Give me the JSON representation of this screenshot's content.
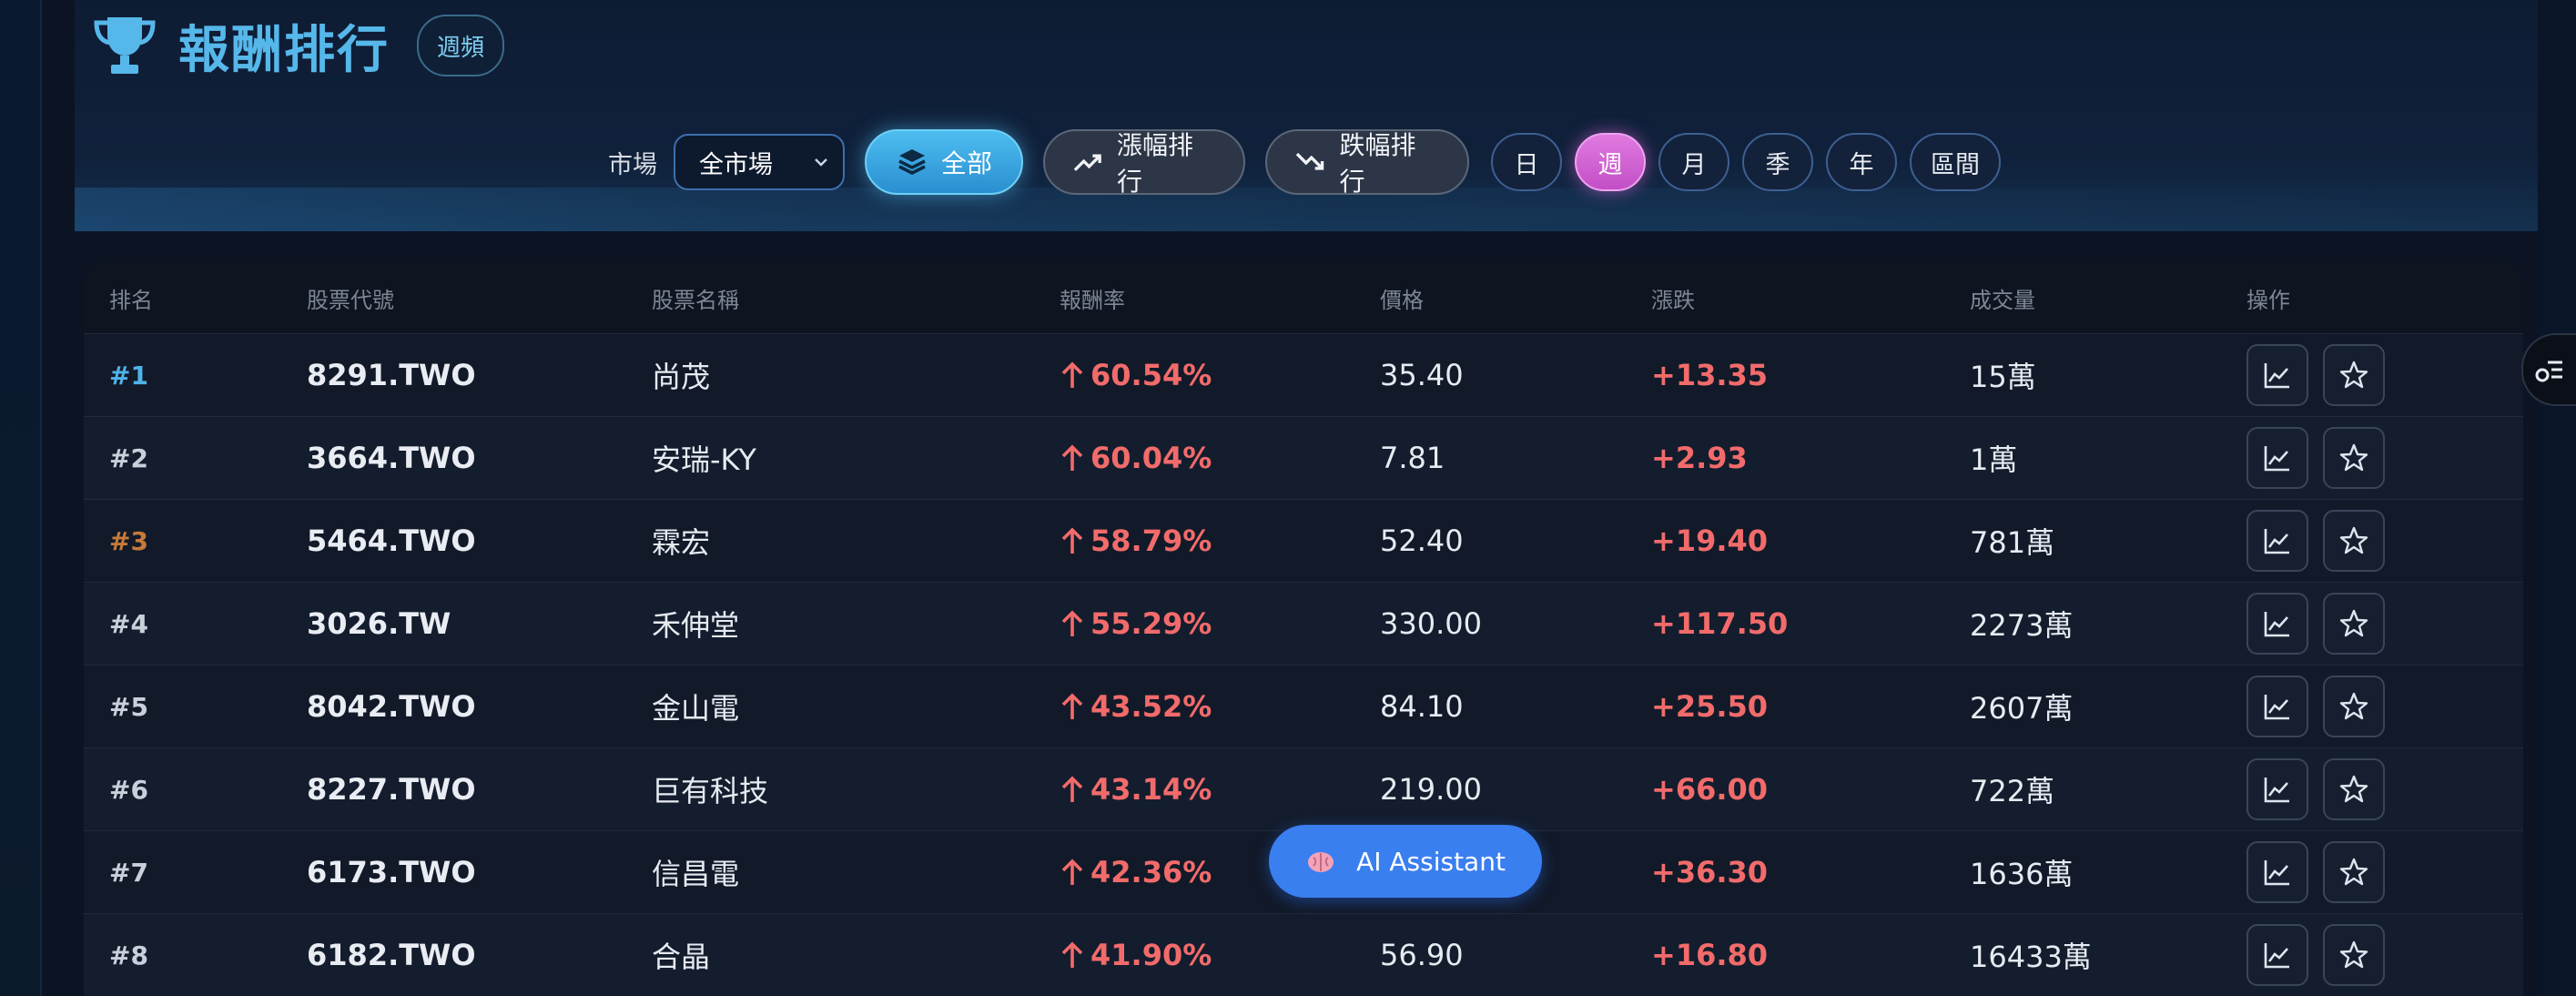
{
  "header": {
    "title": "報酬排行",
    "freq_badge": "週頻"
  },
  "toolbar": {
    "market_label": "市場",
    "market_value": "全市場",
    "all_label": "全部",
    "gain_label": "漲幅排行",
    "loss_label": "跌幅排行",
    "periods": [
      "日",
      "週",
      "月",
      "季",
      "年",
      "區間"
    ],
    "active_period": "週"
  },
  "table": {
    "columns": [
      "排名",
      "股票代號",
      "股票名稱",
      "報酬率",
      "價格",
      "漲跌",
      "成交量",
      "操作"
    ],
    "rows": [
      {
        "rank": "#1",
        "code": "8291.TWO",
        "name": "尚茂",
        "ret": "60.54%",
        "price": "35.40",
        "chg": "+13.35",
        "vol": "15萬"
      },
      {
        "rank": "#2",
        "code": "3664.TWO",
        "name": "安瑞-KY",
        "ret": "60.04%",
        "price": "7.81",
        "chg": "+2.93",
        "vol": "1萬"
      },
      {
        "rank": "#3",
        "code": "5464.TWO",
        "name": "霖宏",
        "ret": "58.79%",
        "price": "52.40",
        "chg": "+19.40",
        "vol": "781萬"
      },
      {
        "rank": "#4",
        "code": "3026.TW",
        "name": "禾伸堂",
        "ret": "55.29%",
        "price": "330.00",
        "chg": "+117.50",
        "vol": "2273萬"
      },
      {
        "rank": "#5",
        "code": "8042.TWO",
        "name": "金山電",
        "ret": "43.52%",
        "price": "84.10",
        "chg": "+25.50",
        "vol": "2607萬"
      },
      {
        "rank": "#6",
        "code": "8227.TWO",
        "name": "巨有科技",
        "ret": "43.14%",
        "price": "219.00",
        "chg": "+66.00",
        "vol": "722萬"
      },
      {
        "rank": "#7",
        "code": "6173.TWO",
        "name": "信昌電",
        "ret": "42.36%",
        "price": "",
        "chg": "+36.30",
        "vol": "1636萬"
      },
      {
        "rank": "#8",
        "code": "6182.TWO",
        "name": "合晶",
        "ret": "41.90%",
        "price": "56.90",
        "chg": "+16.80",
        "vol": "16433萬"
      }
    ]
  },
  "ai_assistant": {
    "label": "AI Assistant"
  },
  "colors": {
    "accent": "#56b7ea",
    "up": "#f26b6b",
    "active_period": "#d266d6",
    "ai": "#3a7ff0"
  }
}
